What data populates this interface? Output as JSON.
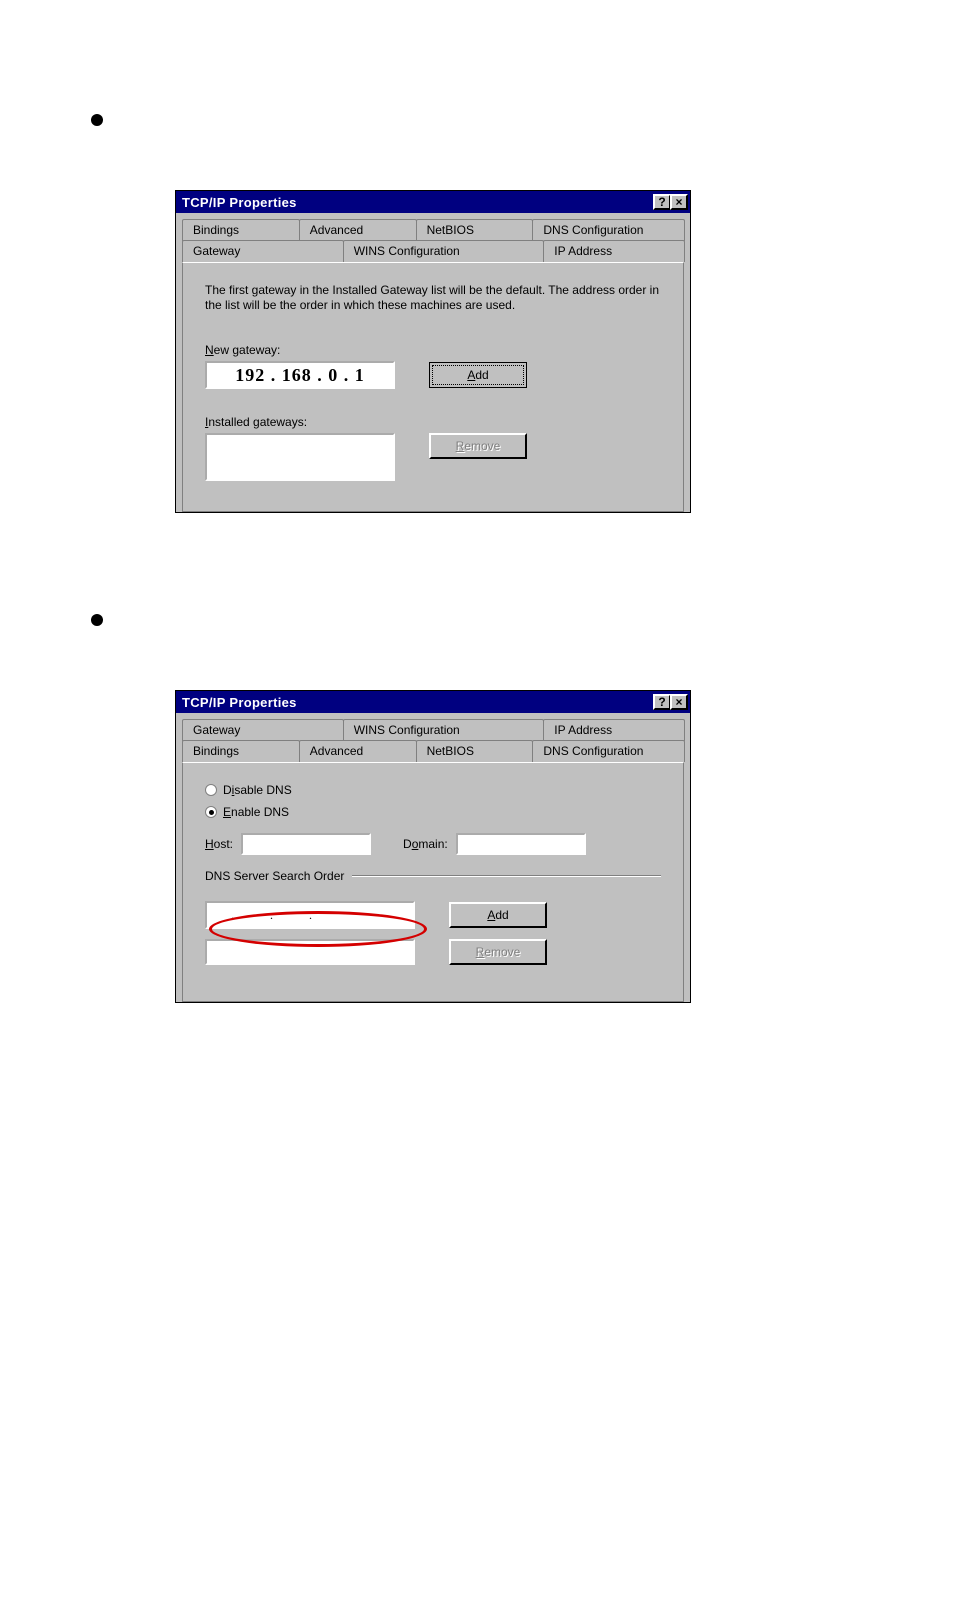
{
  "bullets": {
    "b1": "•",
    "b2": "•"
  },
  "window1": {
    "title": "TCP/IP Properties",
    "help_glyph": "?",
    "close_glyph": "×",
    "tabs_row1": [
      "Bindings",
      "Advanced",
      "NetBIOS",
      "DNS Configuration"
    ],
    "tabs_row2": [
      "Gateway",
      "WINS Configuration",
      "IP Address"
    ],
    "desc": "The first gateway in the Installed Gateway list will be the default. The address order in the list will be the order in which these machines are used.",
    "new_gateway_label": "New gateway:",
    "new_gateway_value": "192 . 168 .  0  .  1",
    "add_label": "Add",
    "installed_label": "Installed gateways:",
    "remove_label": "Remove"
  },
  "window2": {
    "title": "TCP/IP Properties",
    "help_glyph": "?",
    "close_glyph": "×",
    "tabs_row1": [
      "Gateway",
      "WINS Configuration",
      "IP Address"
    ],
    "tabs_row2": [
      "Bindings",
      "Advanced",
      "NetBIOS",
      "DNS Configuration"
    ],
    "disable_dns": "Disable DNS",
    "enable_dns": "Enable DNS",
    "host_label": "Host:",
    "domain_label": "Domain:",
    "dns_search_label": "DNS Server Search Order",
    "ip_dots": ".     .     .",
    "add_label": "Add",
    "remove_label": "Remove"
  }
}
